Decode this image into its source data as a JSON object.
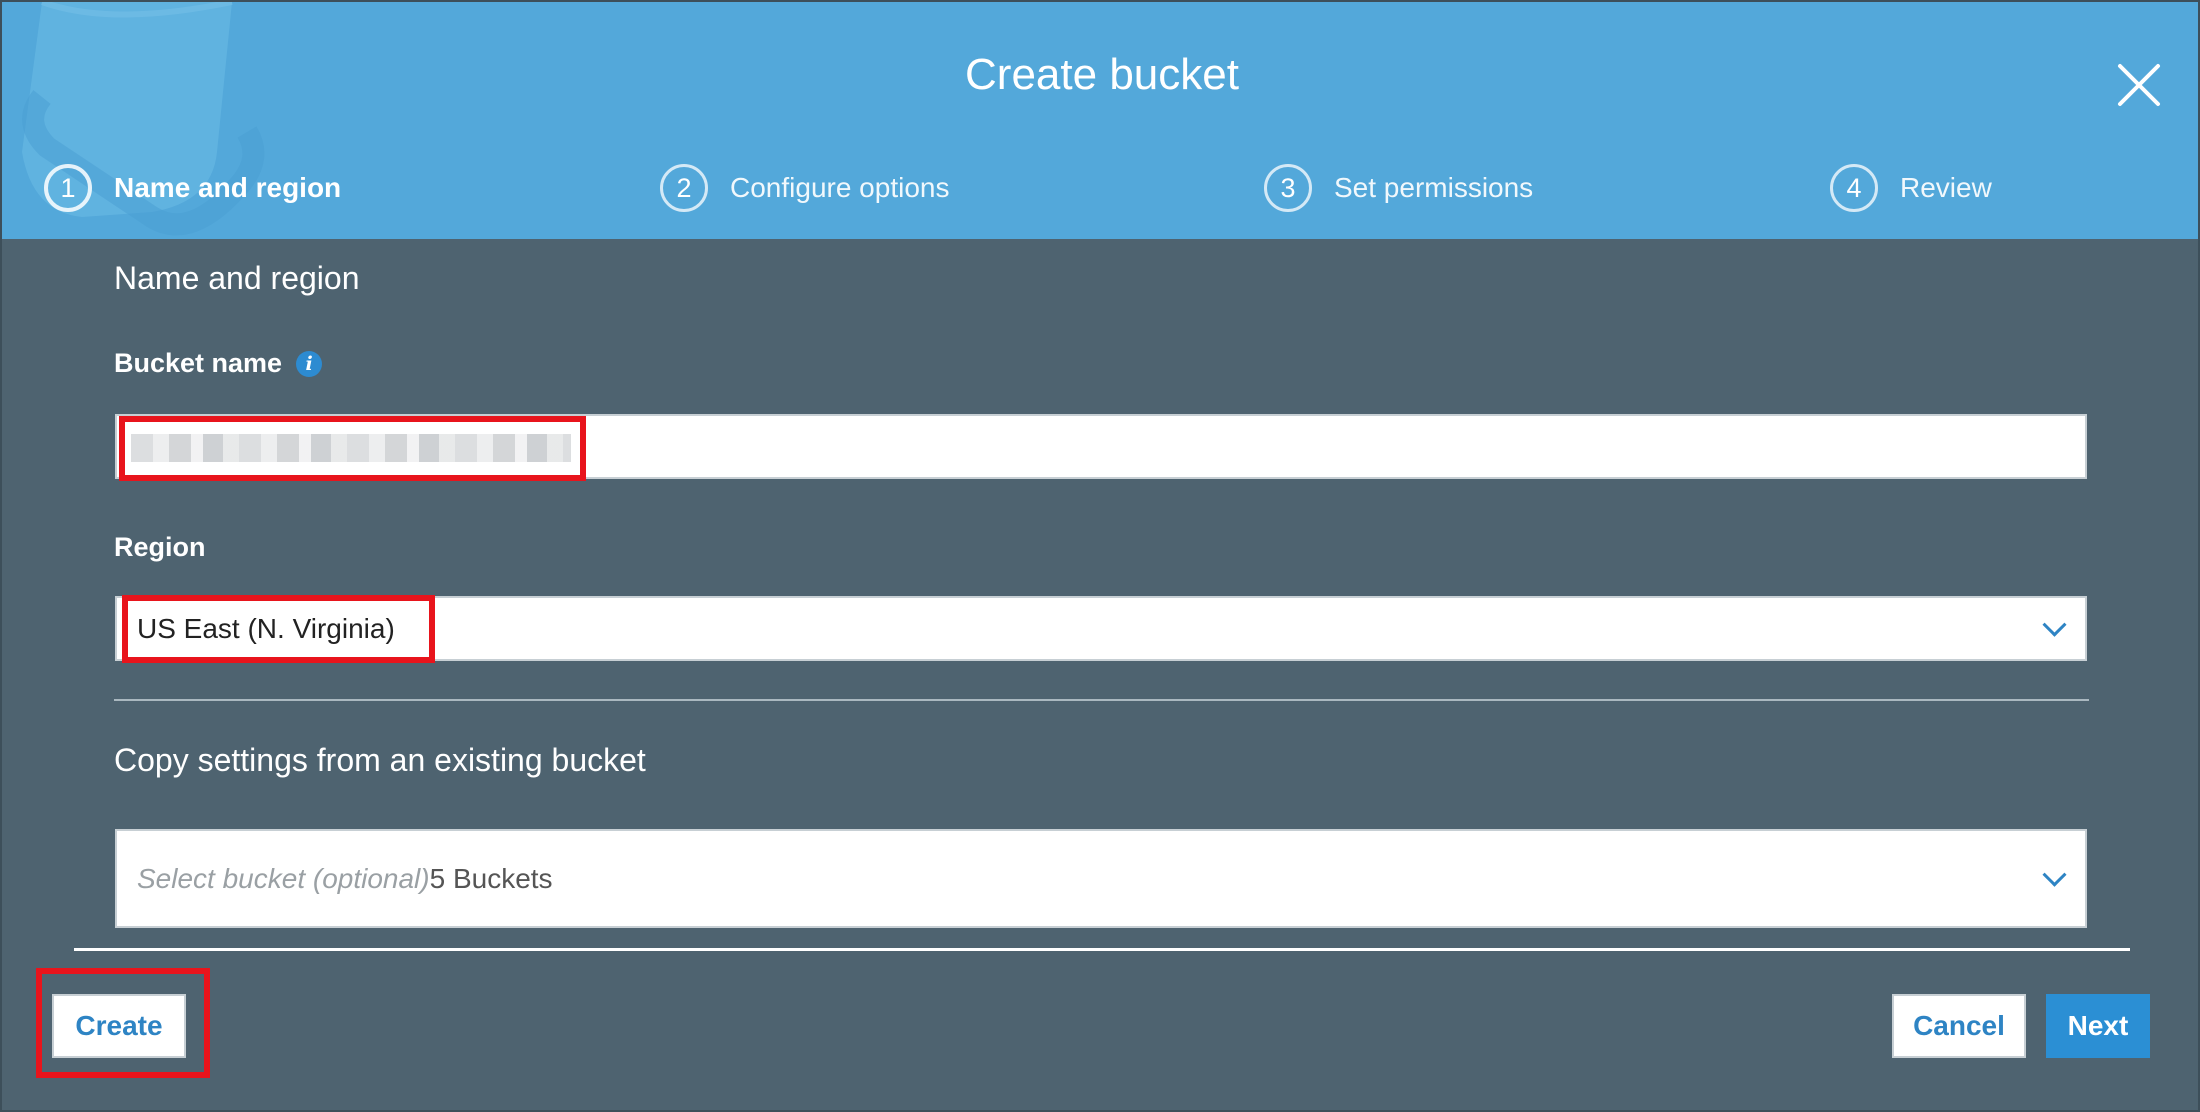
{
  "dialog": {
    "title": "Create bucket",
    "close_icon": "close-icon"
  },
  "steps": [
    {
      "number": "1",
      "label": "Name and region",
      "active": true
    },
    {
      "number": "2",
      "label": "Configure options",
      "active": false
    },
    {
      "number": "3",
      "label": "Set permissions",
      "active": false
    },
    {
      "number": "4",
      "label": "Review",
      "active": false
    }
  ],
  "form": {
    "section_title": "Name and region",
    "bucket_name": {
      "label": "Bucket name",
      "info_icon": "info-icon",
      "value": ""
    },
    "region": {
      "label": "Region",
      "value": "US East (N. Virginia)"
    },
    "copy_settings": {
      "title": "Copy settings from an existing bucket",
      "placeholder": "Select bucket (optional)",
      "count": "5 Buckets"
    }
  },
  "footer": {
    "create_label": "Create",
    "cancel_label": "Cancel",
    "next_label": "Next"
  },
  "colors": {
    "header": "#53a8da",
    "body": "#4e6370",
    "accent": "#2b8fd4",
    "highlight": "#e8141c"
  }
}
